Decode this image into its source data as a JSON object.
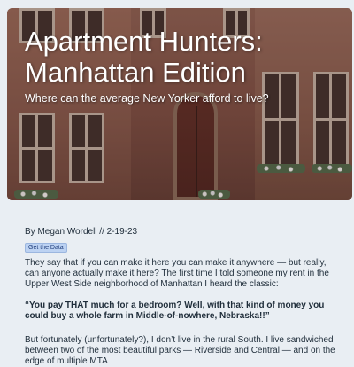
{
  "hero": {
    "title": "Apartment Hunters: Manhattan Edition",
    "subtitle": "Where can the average New Yorker afford to live?",
    "image_description_icon": "brownstone-facade-image"
  },
  "article": {
    "byline": "By Megan Wordell // 2-19-23",
    "data_button_label": "Get the Data",
    "paragraph_1": "They say that if you can make it here you can make it anywhere — but really, can anyone actually make it here? The first time I told someone my rent in the Upper West Side neighborhood of Manhattan I heard the classic:",
    "quote": "“You pay THAT much for a bedroom? Well, with that kind of money you could buy a whole farm in Middle-of-nowhere, Nebraska!!”",
    "paragraph_2": "But fortunately (unfortunately?), I don’t live in the rural South. I live sandwiched between two of the most beautiful parks — Riverside and Central — and on the edge of multiple MTA"
  },
  "colors": {
    "page_background": "#e9eef3",
    "text": "#1f2d3a",
    "button_background": "#bcd2f2"
  }
}
